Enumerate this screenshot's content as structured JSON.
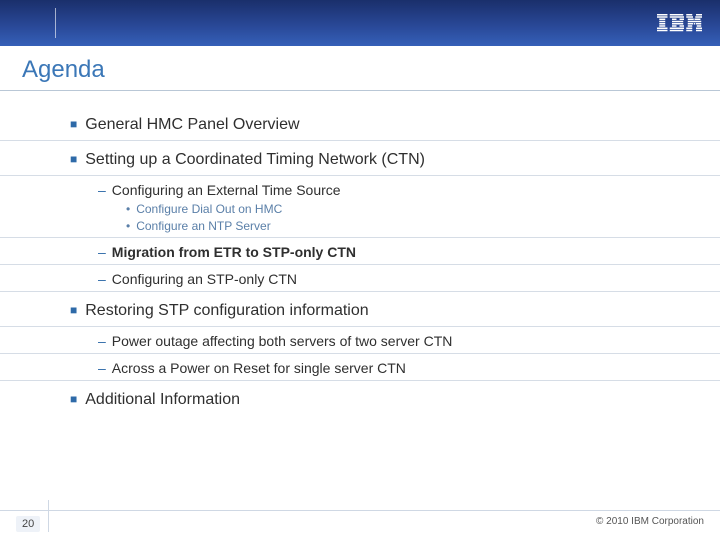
{
  "header": {
    "logo_name": "ibm-logo"
  },
  "title": "Agenda",
  "agenda": [
    {
      "text": "General HMC Panel Overview",
      "level": 1
    },
    {
      "text": "Setting up a Coordinated Timing Network (CTN)",
      "level": 1
    },
    {
      "text": "Configuring an External Time Source",
      "level": 2
    },
    {
      "text": "Configure Dial Out on HMC",
      "level": 3
    },
    {
      "text": "Configure an NTP Server",
      "level": 3
    },
    {
      "text": "Migration from ETR to STP-only CTN",
      "level": 2,
      "bold": true
    },
    {
      "text": "Configuring an STP-only CTN",
      "level": 2
    },
    {
      "text": "Restoring STP configuration information",
      "level": 1
    },
    {
      "text": "Power outage affecting both servers of two server CTN",
      "level": 2
    },
    {
      "text": "Across a Power on Reset for single server CTN",
      "level": 2
    },
    {
      "text": "Additional Information",
      "level": 1
    }
  ],
  "footer": {
    "page": "20",
    "copyright": "© 2010 IBM Corporation"
  }
}
